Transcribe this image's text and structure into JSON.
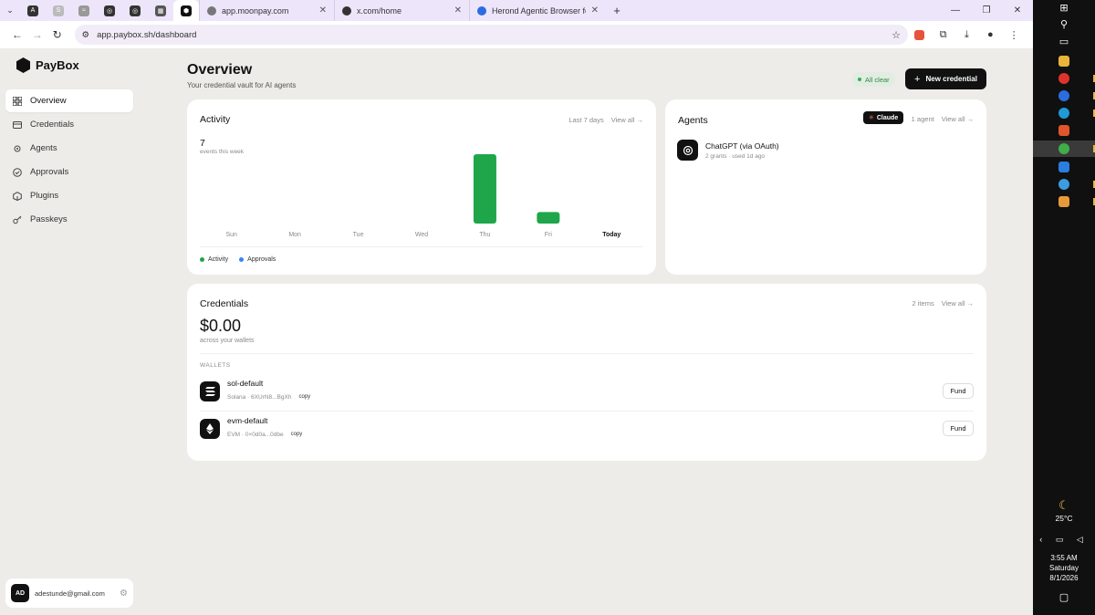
{
  "browser": {
    "pinned_tabs": [
      {
        "icon": "anthropic-icon",
        "glyph": "A"
      },
      {
        "icon": "s-icon",
        "glyph": "S"
      },
      {
        "icon": "app-icon",
        "glyph": "≈"
      },
      {
        "icon": "openai-icon",
        "glyph": "◎"
      },
      {
        "icon": "openai-icon",
        "glyph": "◎"
      },
      {
        "icon": "app-icon",
        "glyph": "▦"
      },
      {
        "icon": "paybox-icon",
        "glyph": "⬢"
      }
    ],
    "tabs": [
      {
        "title": "app.moonpay.com",
        "color": "#7b7b7b"
      },
      {
        "title": "x.com/home",
        "color": "#333333"
      },
      {
        "title": "Herond Agentic Browser for We",
        "color": "#2b6de0"
      }
    ],
    "url": "app.paybox.sh/dashboard"
  },
  "app": {
    "name": "PayBox",
    "nav": [
      {
        "label": "Overview",
        "icon": "grid-icon",
        "active": true
      },
      {
        "label": "Credentials",
        "icon": "card-icon",
        "active": false
      },
      {
        "label": "Agents",
        "icon": "agent-icon",
        "active": false
      },
      {
        "label": "Approvals",
        "icon": "check-circle-icon",
        "active": false
      },
      {
        "label": "Plugins",
        "icon": "cube-icon",
        "active": false
      },
      {
        "label": "Passkeys",
        "icon": "key-icon",
        "active": false
      }
    ],
    "user": {
      "initials": "AD",
      "email": "adestunde@gmail.com"
    }
  },
  "header": {
    "title": "Overview",
    "subtitle": "Your credential vault for AI agents",
    "status": "All clear",
    "new_button": "New credential"
  },
  "activity": {
    "title": "Activity",
    "range": "Last 7 days",
    "view_all": "View all →",
    "count": "7",
    "count_label": "events this week",
    "legend": [
      {
        "label": "Activity",
        "color": "#1fa64a"
      },
      {
        "label": "Approvals",
        "color": "#3b82f6"
      }
    ]
  },
  "chart_data": {
    "type": "bar",
    "categories": [
      "Sun",
      "Mon",
      "Tue",
      "Wed",
      "Thu",
      "Fri",
      "Today"
    ],
    "values": [
      0,
      0,
      0,
      0,
      6,
      1,
      0
    ],
    "highlight_category": "Today",
    "ylim": [
      0,
      6
    ],
    "bar_color": "#1fa64a",
    "grid": false
  },
  "agents": {
    "title": "Agents",
    "tag": "Claude",
    "count": "1 agent",
    "view_all": "View all →",
    "items": [
      {
        "name": "ChatGPT (via OAuth)",
        "meta": "2 grants · used 1d ago"
      }
    ]
  },
  "credentials": {
    "title": "Credentials",
    "count": "2 items",
    "view_all": "View all →",
    "balance": "$0.00",
    "balance_label": "across your wallets",
    "section_label": "WALLETS",
    "wallets": [
      {
        "name": "sol-default",
        "address": "Solana · 6XUrN8...BgXh",
        "copy": "copy",
        "action": "Fund"
      },
      {
        "name": "evm-default",
        "address": "EVM · 0×0d0a...0dbe",
        "copy": "copy",
        "action": "Fund"
      }
    ]
  },
  "taskbar": {
    "weather": "25°C",
    "time": "3:55 AM",
    "day": "Saturday",
    "date": "8/1/2026"
  }
}
